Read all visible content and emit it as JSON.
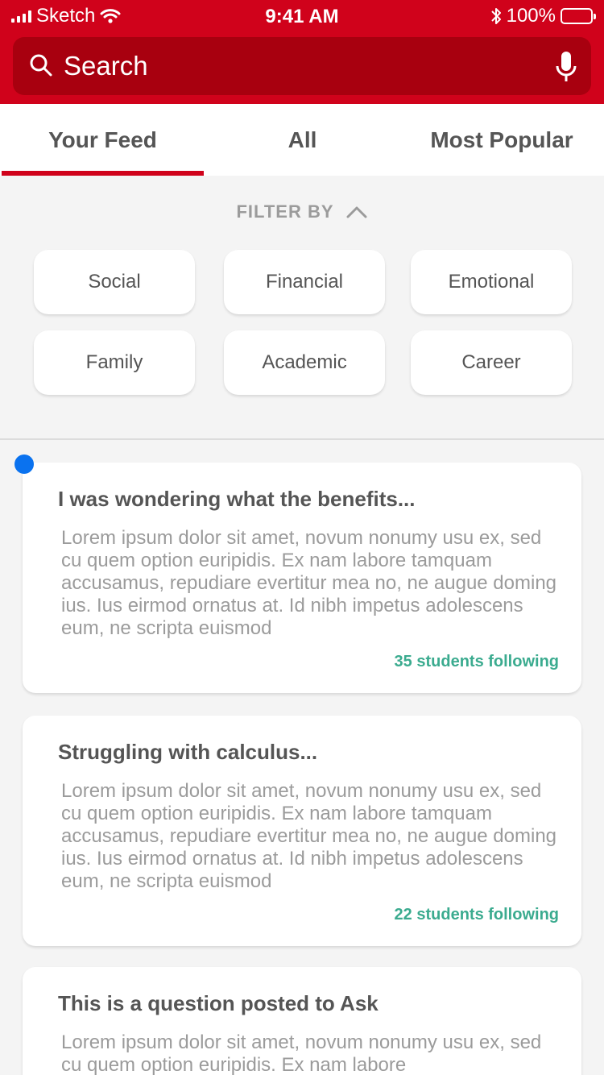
{
  "status_bar": {
    "carrier": "Sketch",
    "time": "9:41 AM",
    "battery": "100%"
  },
  "search": {
    "placeholder": "Search"
  },
  "tabs": [
    {
      "label": "Your Feed",
      "active": true
    },
    {
      "label": "All",
      "active": false
    },
    {
      "label": "Most Popular",
      "active": false
    }
  ],
  "filter": {
    "heading": "FILTER BY",
    "chips": [
      "Social",
      "Financial",
      "Emotional",
      "Family",
      "Academic",
      "Career"
    ]
  },
  "posts": [
    {
      "title": "I was wondering what the benefits...",
      "body": "Lorem ipsum dolor sit amet, novum nonumy usu ex, sed cu quem option euripidis. Ex nam labore tamquam accusamus, repudiare evertitur mea no, ne augue doming ius. Ius eirmod ornatus at. Id nibh impetus adolescens eum, ne scripta euismod",
      "following": "35 students following",
      "unread": true
    },
    {
      "title": "Struggling with calculus...",
      "body": "Lorem ipsum dolor sit amet, novum nonumy usu ex, sed cu quem option euripidis. Ex nam labore tamquam accusamus, repudiare evertitur mea no, ne augue doming ius. Ius eirmod ornatus at. Id nibh impetus adolescens eum, ne scripta euismod",
      "following": "22 students following",
      "unread": false
    },
    {
      "title": "This is a question posted to Ask",
      "body": "Lorem ipsum dolor sit amet, novum nonumy usu ex, sed cu quem option euripidis. Ex nam labore",
      "following": "",
      "unread": false
    }
  ],
  "colors": {
    "brand_red": "#d0021b",
    "search_bg": "#a8000f",
    "follow_green": "#3bab8f",
    "unread_blue": "#0a72ef"
  }
}
